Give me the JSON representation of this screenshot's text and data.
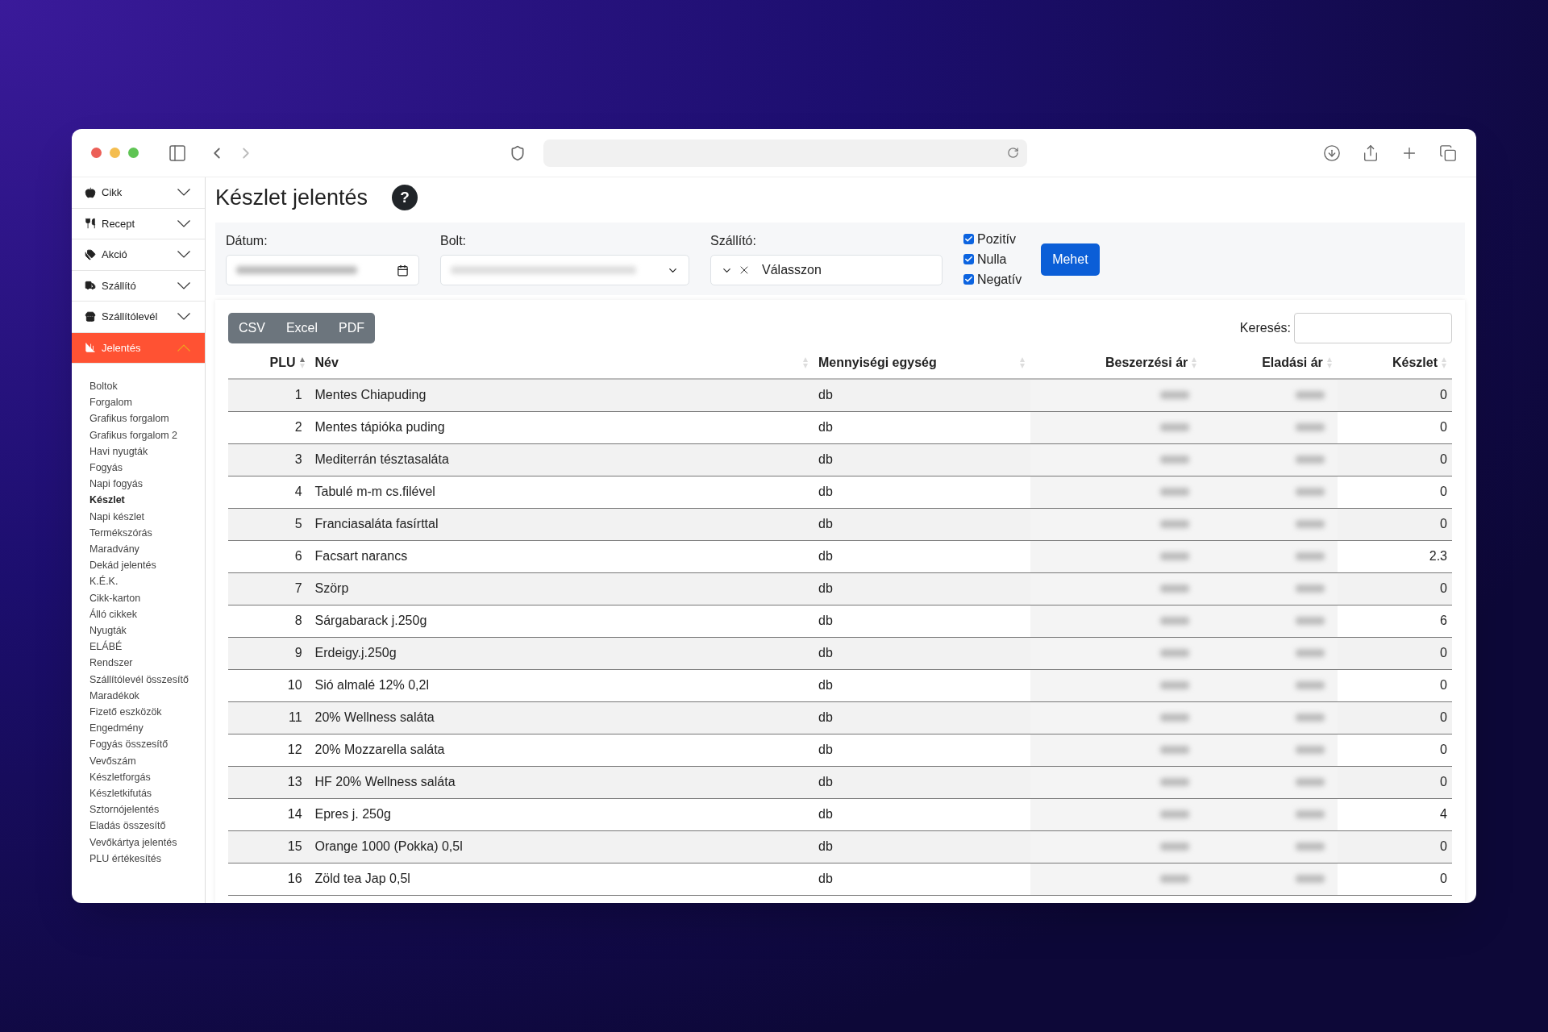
{
  "browser": {
    "back_disabled": false,
    "forward_disabled": true
  },
  "sidebar": {
    "sections": [
      {
        "label": "Cikk",
        "expanded": false,
        "selected": false
      },
      {
        "label": "Recept",
        "expanded": false,
        "selected": false
      },
      {
        "label": "Akció",
        "expanded": false,
        "selected": false
      },
      {
        "label": "Szállító",
        "expanded": false,
        "selected": false
      },
      {
        "label": "Szállítólevél",
        "expanded": false,
        "selected": false
      },
      {
        "label": "Jelentés",
        "expanded": true,
        "selected": true
      }
    ],
    "items": [
      {
        "label": "Boltok",
        "selected": false
      },
      {
        "label": "Forgalom",
        "selected": false
      },
      {
        "label": "Grafikus forgalom",
        "selected": false
      },
      {
        "label": "Grafikus forgalom 2",
        "selected": false
      },
      {
        "label": "Havi nyugták",
        "selected": false
      },
      {
        "label": "Fogyás",
        "selected": false
      },
      {
        "label": "Napi fogyás",
        "selected": false
      },
      {
        "label": "Készlet",
        "selected": true
      },
      {
        "label": "Napi készlet",
        "selected": false
      },
      {
        "label": "Termékszórás",
        "selected": false
      },
      {
        "label": "Maradvány",
        "selected": false
      },
      {
        "label": "Dekád jelentés",
        "selected": false
      },
      {
        "label": "K.É.K.",
        "selected": false
      },
      {
        "label": "Cikk-karton",
        "selected": false
      },
      {
        "label": "Álló cikkek",
        "selected": false
      },
      {
        "label": "Nyugták",
        "selected": false
      },
      {
        "label": "ELÁBÉ",
        "selected": false
      },
      {
        "label": "Rendszer",
        "selected": false
      },
      {
        "label": "Szállítólevél összesítő",
        "selected": false
      },
      {
        "label": "Maradékok",
        "selected": false
      },
      {
        "label": "Fizető eszközök",
        "selected": false
      },
      {
        "label": "Engedmény",
        "selected": false
      },
      {
        "label": "Fogyás összesítő",
        "selected": false
      },
      {
        "label": "Vevőszám",
        "selected": false
      },
      {
        "label": "Készletforgás",
        "selected": false
      },
      {
        "label": "Készletkifutás",
        "selected": false
      },
      {
        "label": "Sztornójelentés",
        "selected": false
      },
      {
        "label": "Eladás összesítő",
        "selected": false
      },
      {
        "label": "Vevőkártya jelentés",
        "selected": false
      },
      {
        "label": "PLU értékesítés",
        "selected": false
      }
    ]
  },
  "page": {
    "title": "Készlet jelentés",
    "help": "?"
  },
  "filters": {
    "date_label": "Dátum:",
    "shop_label": "Bolt:",
    "supplier_label": "Szállító:",
    "supplier_placeholder": "Válasszon",
    "checks": [
      {
        "label": "Pozitív",
        "checked": true
      },
      {
        "label": "Nulla",
        "checked": true
      },
      {
        "label": "Negatív",
        "checked": true
      }
    ],
    "submit": "Mehet"
  },
  "export_buttons": [
    "CSV",
    "Excel",
    "PDF"
  ],
  "search": {
    "label": "Keresés:"
  },
  "table": {
    "columns": [
      {
        "label": "PLU",
        "sorted": true
      },
      {
        "label": "Név",
        "sorted": false
      },
      {
        "label": "Mennyiségi egység",
        "sorted": false
      },
      {
        "label": "Beszerzési ár",
        "sorted": false
      },
      {
        "label": "Eladási ár",
        "sorted": false
      },
      {
        "label": "Készlet",
        "sorted": false
      }
    ],
    "rows": [
      {
        "plu": "1",
        "name": "Mentes Chiapuding",
        "unit": "db",
        "stock": "0"
      },
      {
        "plu": "2",
        "name": "Mentes tápióka puding",
        "unit": "db",
        "stock": "0"
      },
      {
        "plu": "3",
        "name": "Mediterrán tésztasaláta",
        "unit": "db",
        "stock": "0"
      },
      {
        "plu": "4",
        "name": "Tabulé m-m cs.filével",
        "unit": "db",
        "stock": "0"
      },
      {
        "plu": "5",
        "name": "Franciasaláta fasírttal",
        "unit": "db",
        "stock": "0"
      },
      {
        "plu": "6",
        "name": "Facsart narancs",
        "unit": "db",
        "stock": "2.3"
      },
      {
        "plu": "7",
        "name": "Szörp",
        "unit": "db",
        "stock": "0"
      },
      {
        "plu": "8",
        "name": "Sárgabarack j.250g",
        "unit": "db",
        "stock": "6"
      },
      {
        "plu": "9",
        "name": "Erdeigy.j.250g",
        "unit": "db",
        "stock": "0"
      },
      {
        "plu": "10",
        "name": "Sió almalé 12% 0,2l",
        "unit": "db",
        "stock": "0"
      },
      {
        "plu": "11",
        "name": "20% Wellness saláta",
        "unit": "db",
        "stock": "0"
      },
      {
        "plu": "12",
        "name": "20% Mozzarella saláta",
        "unit": "db",
        "stock": "0"
      },
      {
        "plu": "13",
        "name": "HF 20% Wellness saláta",
        "unit": "db",
        "stock": "0"
      },
      {
        "plu": "14",
        "name": "Epres j. 250g",
        "unit": "db",
        "stock": "4"
      },
      {
        "plu": "15",
        "name": "Orange 1000 (Pokka) 0,5l",
        "unit": "db",
        "stock": "0"
      },
      {
        "plu": "16",
        "name": "Zöld tea Jap 0,5l",
        "unit": "db",
        "stock": "0"
      }
    ]
  }
}
